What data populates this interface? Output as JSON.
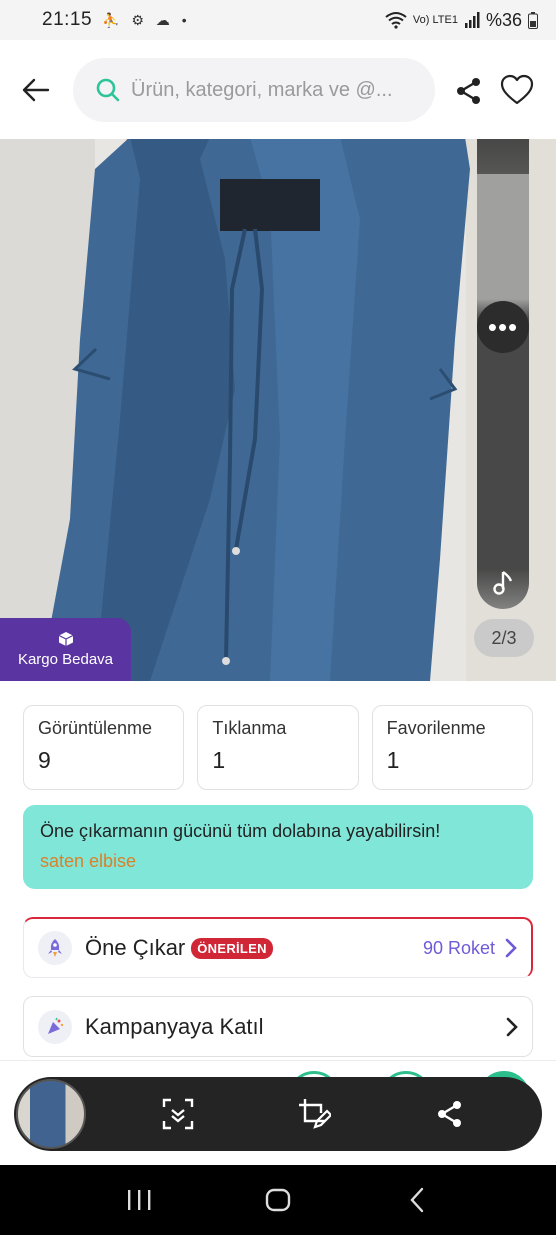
{
  "status_bar": {
    "time": "21:15",
    "notifications": "⛹ ⚙ ☁ •",
    "network": "Vo) LTE1",
    "battery": "%36"
  },
  "header": {
    "search_placeholder": "Ürün, kategori, marka ve @..."
  },
  "product_image": {
    "page_indicator": "2/3",
    "kargo_label": "Kargo Bedava"
  },
  "stats": [
    {
      "label": "Görüntülenme",
      "value": "9"
    },
    {
      "label": "Tıklanma",
      "value": "1"
    },
    {
      "label": "Favorilenme",
      "value": "1"
    }
  ],
  "promo": {
    "message": "Öne çıkarmanın gücünü tüm dolabına yayabilirsin!",
    "link": "saten elbise"
  },
  "actions": {
    "feature": {
      "title": "Öne Çıkar",
      "badge": "ÖNERİLEN",
      "price": "90 Roket"
    },
    "campaign": {
      "title": "Kampanyaya Katıl"
    }
  },
  "colors": {
    "brand_purple": "#5a34a0",
    "promo_teal": "#7fe6d8",
    "badge_red": "#d02636",
    "accent_purple": "#6e5bd6",
    "dress_blue": "#40648f"
  }
}
